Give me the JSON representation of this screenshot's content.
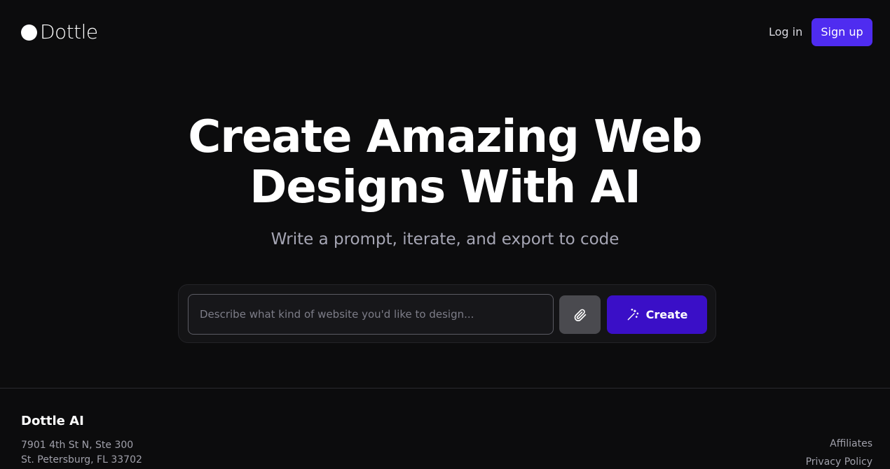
{
  "header": {
    "logo_text": "Dottle",
    "login_label": "Log in",
    "signup_label": "Sign up"
  },
  "hero": {
    "title_line1": "Create Amazing Web",
    "title_line2": "Designs With AI",
    "subtitle": "Write a prompt, iterate, and export to code"
  },
  "prompt": {
    "placeholder": "Describe what kind of website you'd like to design...",
    "value": "",
    "attach_icon": "paperclip-icon",
    "create_icon": "magic-wand-icon",
    "create_label": "Create"
  },
  "footer": {
    "brand": "Dottle AI",
    "address_line1": "7901 4th St N, Ste 300",
    "address_line2": "St. Petersburg, FL 33702",
    "links": [
      "Affiliates",
      "Privacy Policy"
    ]
  },
  "colors": {
    "background": "#0c0c0d",
    "accent_signup": "#4f2cf0",
    "accent_create": "#3a0fc7"
  }
}
